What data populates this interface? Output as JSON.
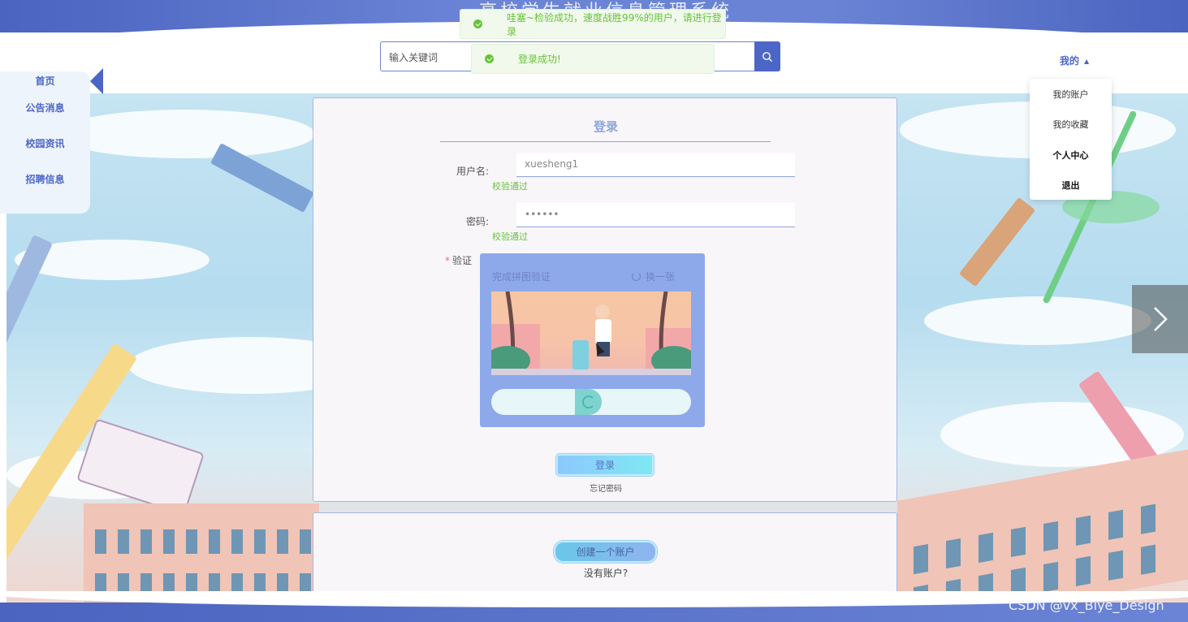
{
  "header": {
    "site_title": "高校学生就业信息管理系统",
    "search_placeholder": "输入关键词",
    "user_menu_label": "我的"
  },
  "toasts": [
    {
      "message": "哇塞~检验成功，速度战胜99%的用户，请进行登录"
    },
    {
      "message": "登录成功!"
    }
  ],
  "dropdown": {
    "items": [
      {
        "label": "我的账户"
      },
      {
        "label": "我的收藏"
      },
      {
        "label": "个人中心"
      },
      {
        "label": "退出"
      }
    ]
  },
  "sidebar": {
    "items": [
      {
        "label": "首页"
      },
      {
        "label": "公告消息"
      },
      {
        "label": "校园资讯"
      },
      {
        "label": "招聘信息"
      }
    ]
  },
  "login": {
    "title": "登录",
    "username_label": "用户名:",
    "username_value": "xuesheng1",
    "username_status": "校验通过",
    "password_label": "密码:",
    "password_value": "••••••",
    "password_status": "校验通过",
    "captcha_label": "验证",
    "captcha_title": "完成拼图验证",
    "captcha_refresh": "换一张",
    "submit_label": "登录",
    "forgot_label": "忘记密码"
  },
  "register": {
    "create_label": "创建一个账户",
    "no_account_label": "没有账户?"
  },
  "watermark": "CSDN @vx_Biye_Design",
  "colors": {
    "accent": "#4c66c7",
    "success": "#67c23a",
    "panel_border": "#a8b8e4"
  }
}
